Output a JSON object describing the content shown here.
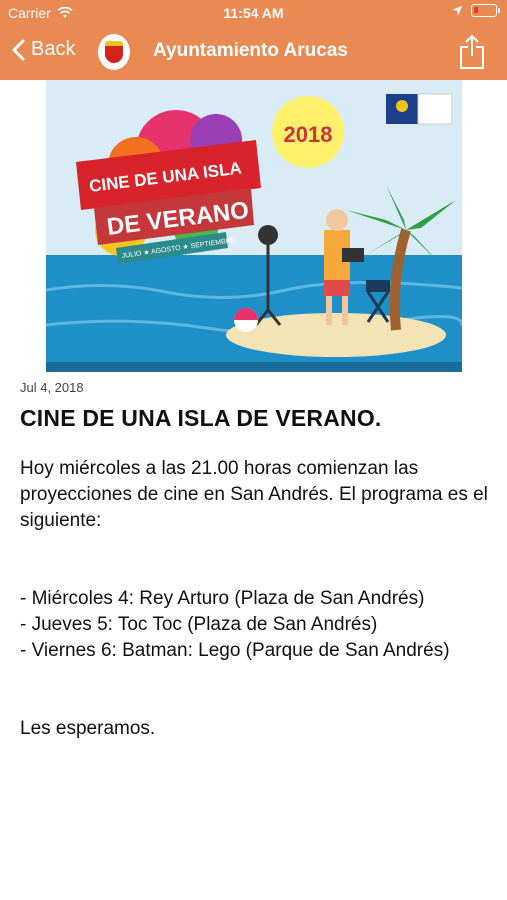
{
  "status_bar": {
    "carrier": "Carrier",
    "time": "11:54 AM"
  },
  "nav": {
    "back_label": "Back",
    "title": "Ayuntamiento Arucas"
  },
  "banner": {
    "heading_line1": "CINE DE UNA ISLA",
    "heading_line2": "DE VERANO",
    "months": "JULIO ★ AGOSTO ★ SEPTIEMBRE",
    "year": "2018"
  },
  "article": {
    "date": "Jul 4, 2018",
    "title": "CINE DE UNA ISLA DE VERANO.",
    "paragraphs": [
      "Hoy miércoles a las 21.00 horas comienzan las proyecciones de cine en San Andrés.  El programa es el siguiente:",
      "- Miércoles 4:  Rey Arturo (Plaza de San Andrés)",
      "- Jueves 5:  Toc Toc (Plaza de San Andrés)",
      "- Viernes 6:  Batman:  Lego (Parque de San Andrés)",
      "Les esperamos."
    ]
  },
  "colors": {
    "nav_background": "#E98A53",
    "nav_text": "#ffffff",
    "text": "#111111"
  },
  "icons": [
    "wifi-icon",
    "location-arrow-icon",
    "battery-icon",
    "chevron-left-icon",
    "crest-logo",
    "share-icon"
  ]
}
